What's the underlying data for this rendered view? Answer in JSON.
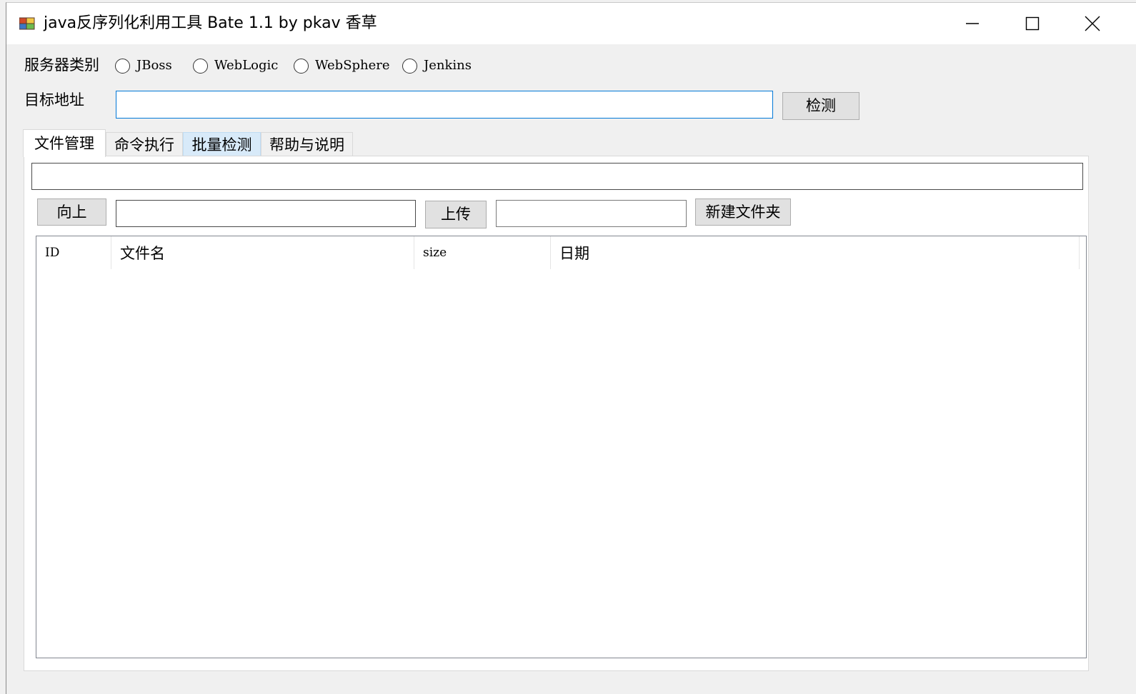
{
  "window": {
    "title": "java反序列化利用工具 Bate 1.1 by pkav 香草"
  },
  "server_type": {
    "label": "服务器类别",
    "options": [
      {
        "label": "JBoss"
      },
      {
        "label": "WebLogic"
      },
      {
        "label": "WebSphere"
      },
      {
        "label": "Jenkins"
      }
    ]
  },
  "target": {
    "label": "目标地址",
    "value": "",
    "detect_label": "检测"
  },
  "tabs": [
    {
      "label": "文件管理"
    },
    {
      "label": "命令执行"
    },
    {
      "label": "批量检测"
    },
    {
      "label": "帮助与说明"
    }
  ],
  "file_manager": {
    "path_value": "",
    "up_label": "向上",
    "upload_path_value": "",
    "upload_label": "上传",
    "folder_name_value": "",
    "new_folder_label": "新建文件夹",
    "columns": [
      {
        "label": "ID"
      },
      {
        "label": "文件名"
      },
      {
        "label": "size"
      },
      {
        "label": "日期"
      }
    ],
    "rows": []
  }
}
